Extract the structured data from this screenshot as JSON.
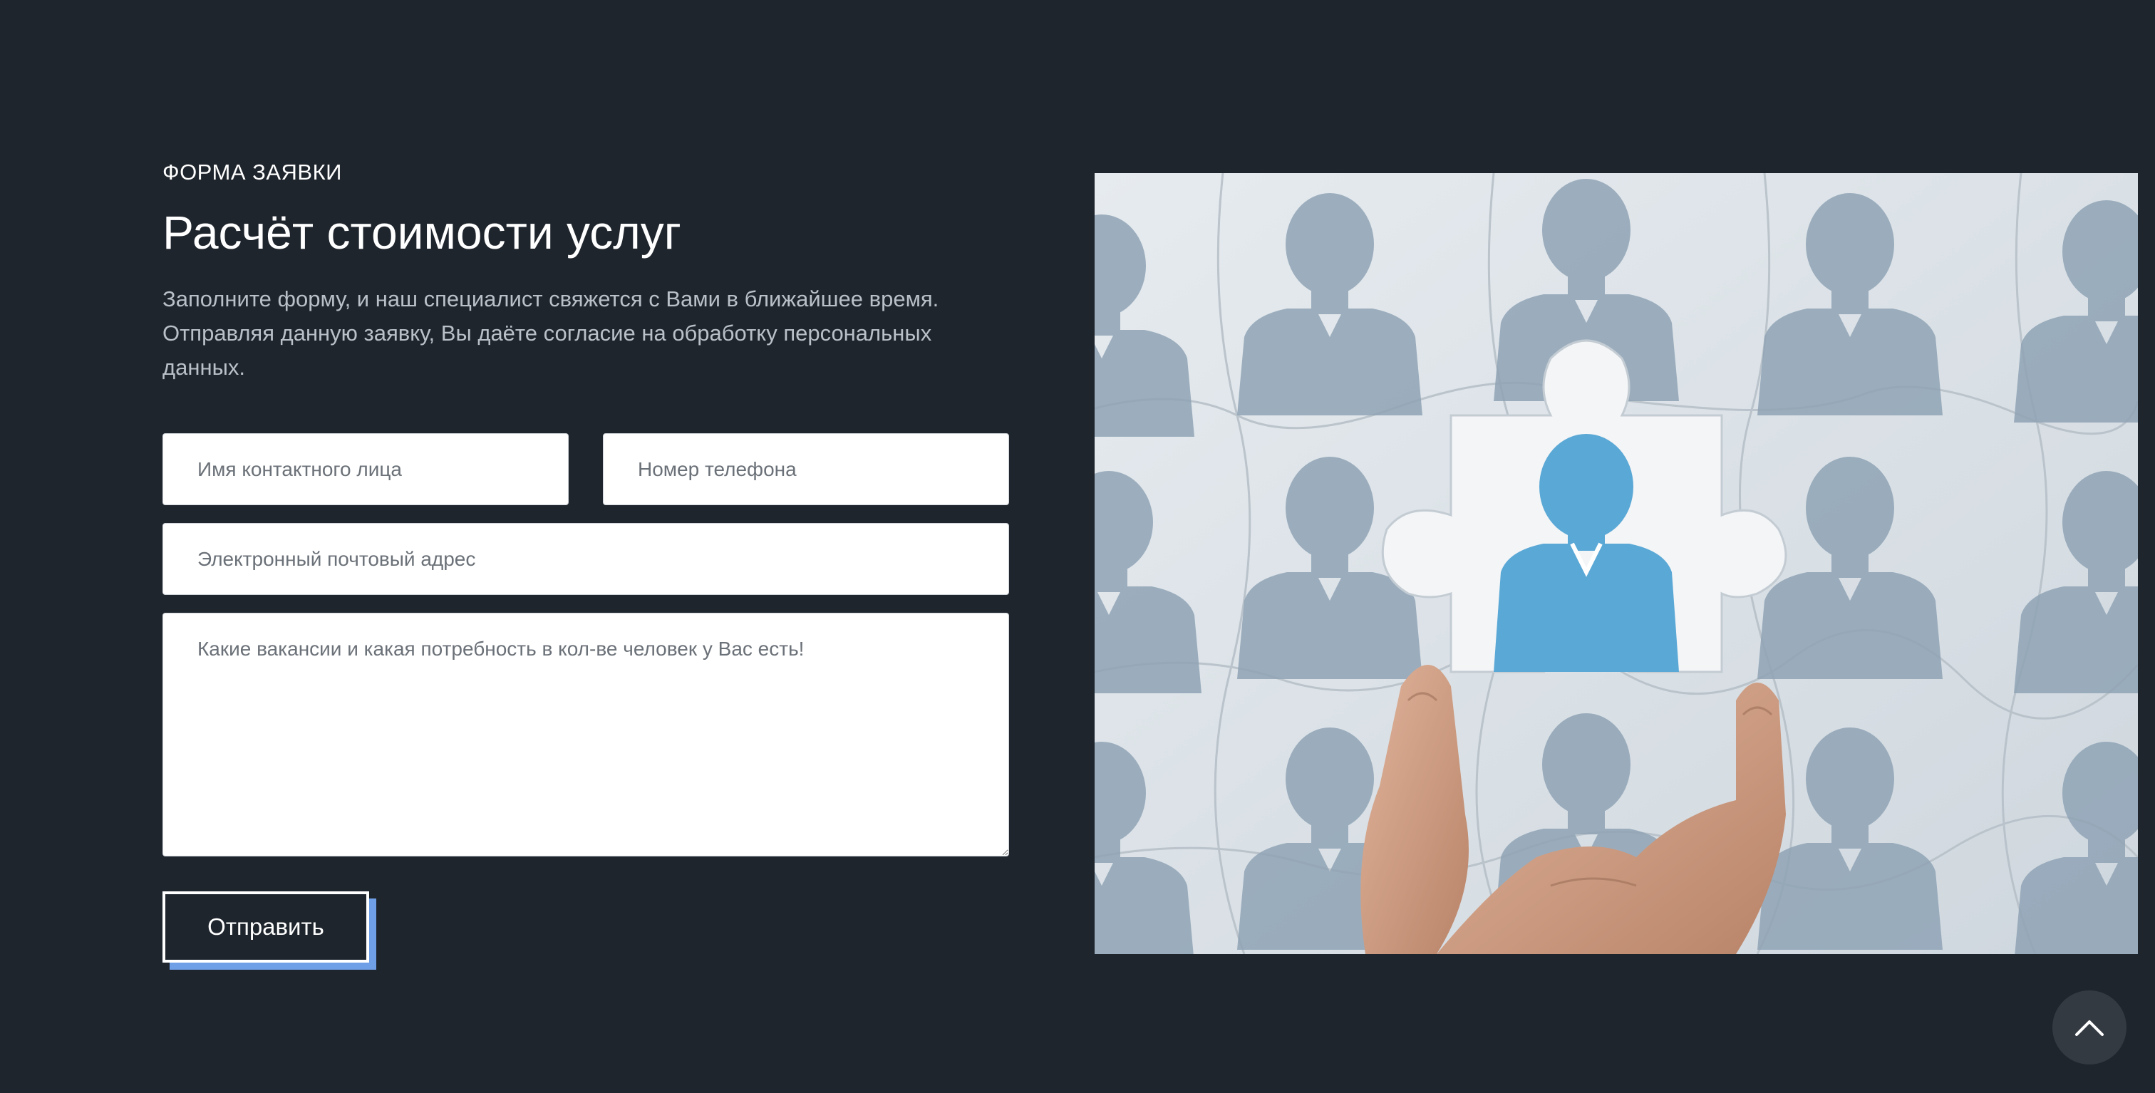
{
  "form": {
    "eyebrow": "ФОРМА ЗАЯВКИ",
    "title": "Расчёт стоимости услуг",
    "description": "Заполните форму, и наш специалист свяжется с Вами в ближайшее время. Отправляя данную заявку, Вы даёте согласие на обработку персональных данных.",
    "fields": {
      "contact_name": {
        "placeholder": "Имя контактного лица",
        "value": ""
      },
      "phone": {
        "placeholder": "Номер телефона",
        "value": ""
      },
      "email": {
        "placeholder": "Электронный почтовый адрес",
        "value": ""
      },
      "message": {
        "placeholder": "Какие вакансии и какая потребность в кол-ве человек у Вас есть!",
        "value": ""
      }
    },
    "submit_label": "Отправить"
  },
  "image": {
    "subject": "hand holding puzzle piece with person silhouette",
    "icon": "puzzle-person-photo"
  },
  "scroll_top": {
    "icon": "chevron-up-icon"
  },
  "colors": {
    "background": "#1f252d",
    "accent_shadow": "#6f9fe6",
    "highlight_piece": "#5aa8d6",
    "silhouette": "#8fa3b5"
  }
}
